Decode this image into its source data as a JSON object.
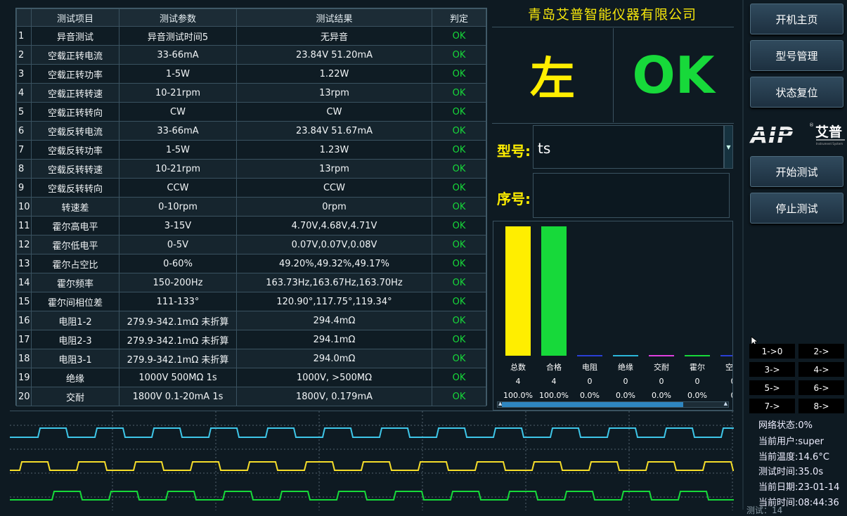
{
  "company": "青岛艾普智能仪器有限公司",
  "side_result": "左",
  "verdict": "OK",
  "table": {
    "headers": [
      "测试项目",
      "测试参数",
      "测试结果",
      "判定"
    ],
    "rows": [
      {
        "no": "1",
        "item": "异音测试",
        "param": "异音测试时间5",
        "result": "无异音",
        "judge": "OK"
      },
      {
        "no": "2",
        "item": "空载正转电流",
        "param": "33-66mA",
        "result": "23.84V 51.20mA",
        "judge": "OK"
      },
      {
        "no": "3",
        "item": "空载正转功率",
        "param": "1-5W",
        "result": "1.22W",
        "judge": "OK"
      },
      {
        "no": "4",
        "item": "空载正转转速",
        "param": "10-21rpm",
        "result": "13rpm",
        "judge": "OK"
      },
      {
        "no": "5",
        "item": "空载正转转向",
        "param": "CW",
        "result": "CW",
        "judge": "OK"
      },
      {
        "no": "6",
        "item": "空载反转电流",
        "param": "33-66mA",
        "result": "23.84V 51.67mA",
        "judge": "OK"
      },
      {
        "no": "7",
        "item": "空载反转功率",
        "param": "1-5W",
        "result": "1.23W",
        "judge": "OK"
      },
      {
        "no": "8",
        "item": "空载反转转速",
        "param": "10-21rpm",
        "result": "13rpm",
        "judge": "OK"
      },
      {
        "no": "9",
        "item": "空载反转转向",
        "param": "CCW",
        "result": "CCW",
        "judge": "OK"
      },
      {
        "no": "10",
        "item": "转速差",
        "param": "0-10rpm",
        "result": "0rpm",
        "judge": "OK"
      },
      {
        "no": "11",
        "item": "霍尔高电平",
        "param": "3-15V",
        "result": "4.70V,4.68V,4.71V",
        "judge": "OK"
      },
      {
        "no": "12",
        "item": "霍尔低电平",
        "param": "0-5V",
        "result": "0.07V,0.07V,0.08V",
        "judge": "OK"
      },
      {
        "no": "13",
        "item": "霍尔占空比",
        "param": "0-60%",
        "result": "49.20%,49.32%,49.17%",
        "judge": "OK"
      },
      {
        "no": "14",
        "item": "霍尔频率",
        "param": "150-200Hz",
        "result": "163.73Hz,163.67Hz,163.70Hz",
        "judge": "OK"
      },
      {
        "no": "15",
        "item": "霍尔间相位差",
        "param": "111-133°",
        "result": "120.90°,117.75°,119.34°",
        "judge": "OK"
      },
      {
        "no": "16",
        "item": "电阻1-2",
        "param": "279.9-342.1mΩ 未折算",
        "result": "294.4mΩ",
        "judge": "OK"
      },
      {
        "no": "17",
        "item": "电阻2-3",
        "param": "279.9-342.1mΩ 未折算",
        "result": "294.1mΩ",
        "judge": "OK"
      },
      {
        "no": "18",
        "item": "电阻3-1",
        "param": "279.9-342.1mΩ 未折算",
        "result": "294.0mΩ",
        "judge": "OK"
      },
      {
        "no": "19",
        "item": "绝缘",
        "param": "1000V 500MΩ 1s",
        "result": "1000V, >500MΩ",
        "judge": "OK"
      },
      {
        "no": "20",
        "item": "交耐",
        "param": "1800V 0.1-20mA 1s",
        "result": "1800V, 0.179mA",
        "judge": "OK"
      }
    ]
  },
  "model": {
    "label": "型号:",
    "value": "ts"
  },
  "serial": {
    "label": "序号:",
    "value": ""
  },
  "chart_data": {
    "type": "bar",
    "categories": [
      "总数",
      "合格",
      "电阻",
      "绝缘",
      "交耐",
      "霍尔",
      "空载"
    ],
    "values": [
      4,
      4,
      0,
      0,
      0,
      0,
      0
    ],
    "percents": [
      "100.0%",
      "100.0%",
      "0.0%",
      "0.0%",
      "0.0%",
      "0.0%",
      "0"
    ],
    "colors": [
      "#ffee00",
      "#17d93a",
      "#2a3fd6",
      "#2bb6d9",
      "#e040e0",
      "#17d93a",
      "#2a3fd6"
    ],
    "ylim": [
      0,
      4
    ]
  },
  "waveform_colors": [
    "#3ec6e8",
    "#f5dd2a",
    "#17d93a"
  ],
  "buttons": {
    "home": "开机主页",
    "model_mgmt": "型号管理",
    "reset": "状态复位",
    "start": "开始测试",
    "stop": "停止测试"
  },
  "logo": {
    "text": "AIP",
    "cn": "艾普",
    "sub": "Instrument System"
  },
  "channels": [
    "1->0",
    "2->",
    "3->",
    "4->",
    "5->",
    "6->",
    "7->",
    "8->"
  ],
  "status": {
    "network": "网络状态:0%",
    "user": "当前用户:super",
    "temperature": "当前温度:14.6°C",
    "test_time": "测试时间:35.0s",
    "date": "当前日期:23-01-14",
    "time": "当前时间:08:44:36"
  },
  "bottom_fragment": "测试：14"
}
